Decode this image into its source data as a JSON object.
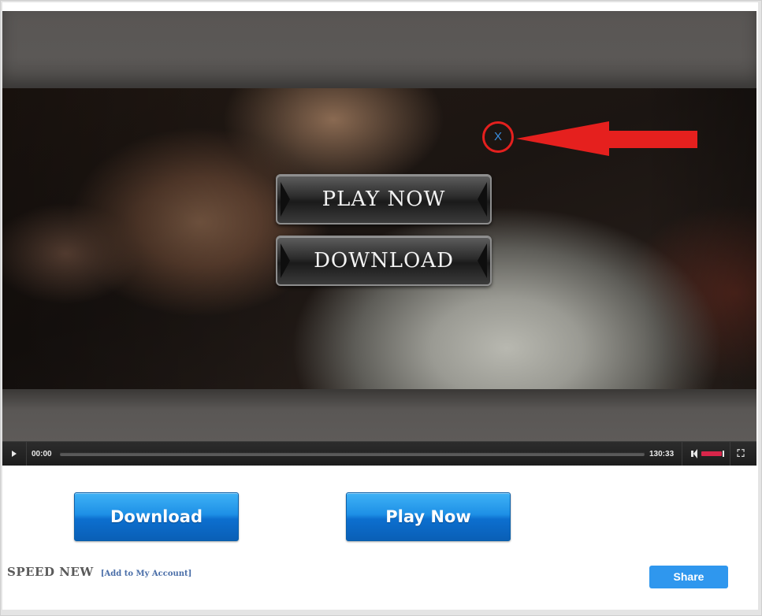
{
  "player": {
    "overlay_play_label": "PLAY NOW",
    "overlay_download_label": "DOWNLOAD",
    "close_label": "X",
    "time_current": "00:00",
    "time_total": "130:33",
    "progress_fraction": 0.0,
    "volume_fraction": 0.85
  },
  "actions": {
    "download_label": "Download",
    "play_now_label": "Play Now"
  },
  "footer": {
    "title": "SPEED NEW",
    "add_account_link": "[Add to My Account]",
    "share_label": "Share"
  },
  "colors": {
    "annotation_red": "#e5201e",
    "button_blue": "#1e90e6",
    "volume_red": "#d8264a"
  },
  "icons": [
    "play-icon",
    "volume-icon",
    "fullscreen-icon",
    "close-icon",
    "arrow-annotation-icon"
  ]
}
